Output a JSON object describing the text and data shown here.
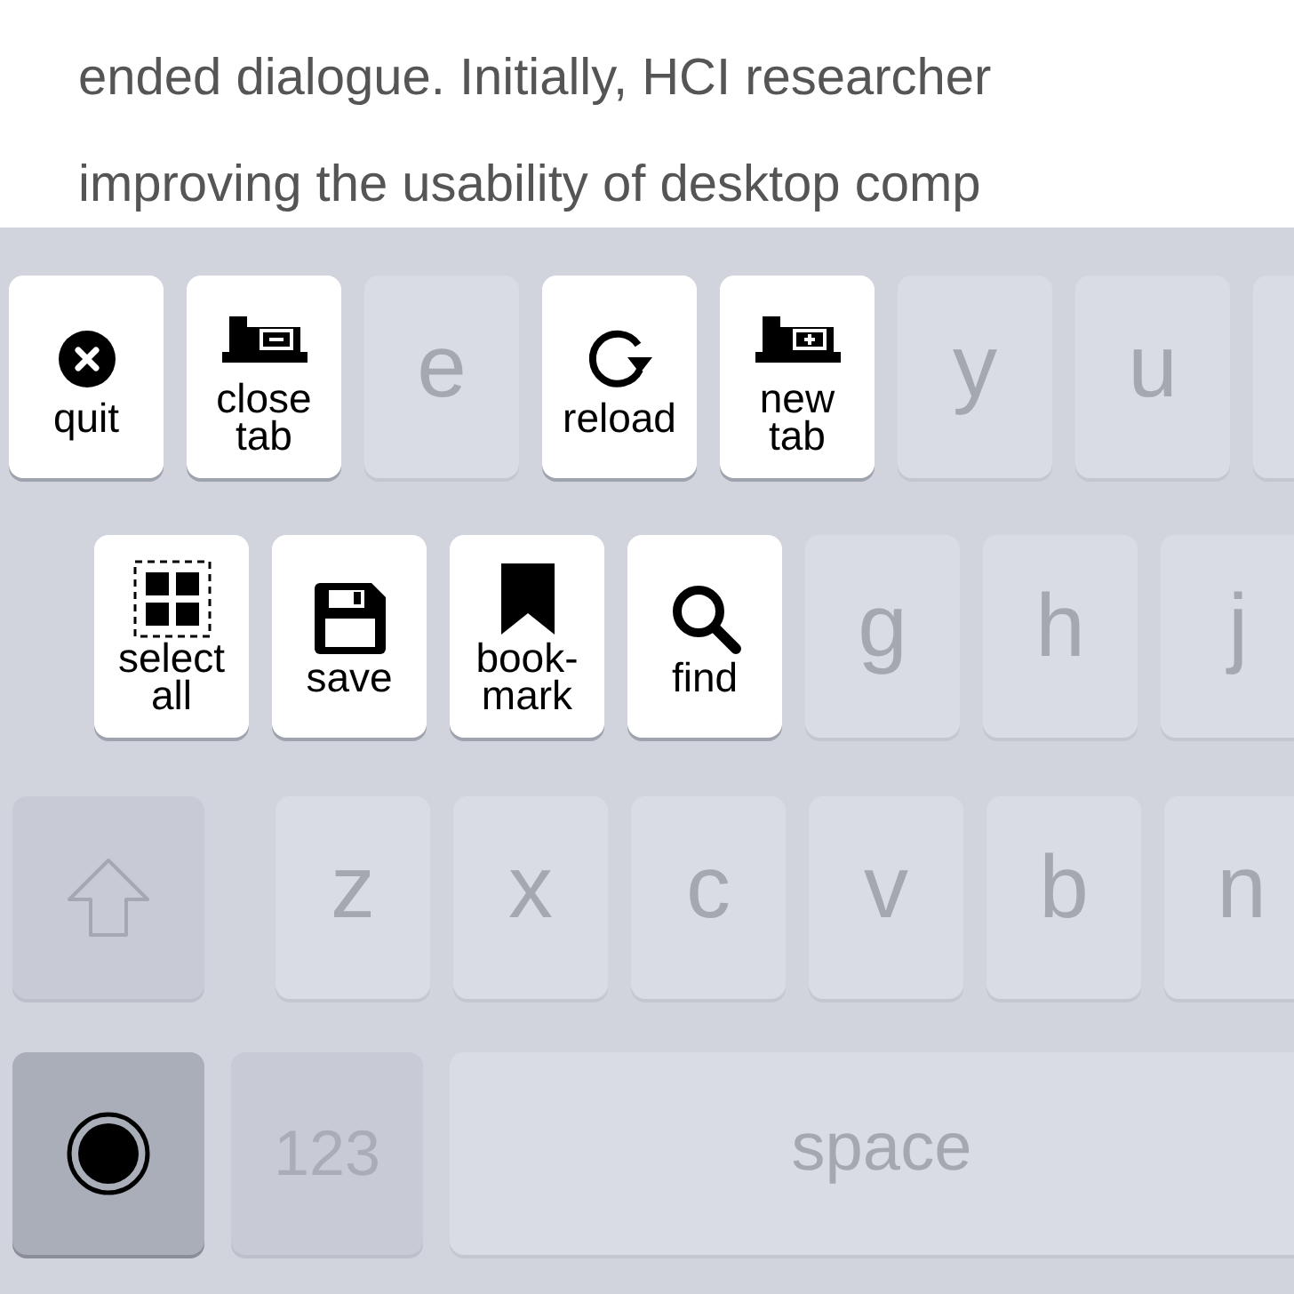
{
  "document": {
    "lines": [
      "ended dialogue. Initially, HCI researcher",
      "improving the usability of desktop comp"
    ]
  },
  "keyboard": {
    "rows": [
      {
        "keys": [
          {
            "kind": "command",
            "label": "quit"
          },
          {
            "kind": "command",
            "label": "close tab"
          },
          {
            "kind": "letter",
            "label": "e"
          },
          {
            "kind": "command",
            "label": "reload"
          },
          {
            "kind": "command",
            "label": "new tab"
          },
          {
            "kind": "letter",
            "label": "y"
          },
          {
            "kind": "letter",
            "label": "u"
          },
          {
            "kind": "blank"
          }
        ]
      },
      {
        "keys": [
          {
            "kind": "command",
            "label": "select all"
          },
          {
            "kind": "command",
            "label": "save"
          },
          {
            "kind": "command",
            "label": "book-mark"
          },
          {
            "kind": "command",
            "label": "find"
          },
          {
            "kind": "letter",
            "label": "g"
          },
          {
            "kind": "letter",
            "label": "h"
          },
          {
            "kind": "letter",
            "label": "j"
          }
        ]
      },
      {
        "keys": [
          {
            "kind": "shift"
          },
          {
            "kind": "letter",
            "label": "z"
          },
          {
            "kind": "letter",
            "label": "x"
          },
          {
            "kind": "letter",
            "label": "c"
          },
          {
            "kind": "letter",
            "label": "v"
          },
          {
            "kind": "letter",
            "label": "b"
          },
          {
            "kind": "letter",
            "label": "n"
          }
        ]
      },
      {
        "keys": [
          {
            "kind": "record",
            "active": true
          },
          {
            "kind": "numbers",
            "label": "123"
          },
          {
            "kind": "space",
            "label": "space"
          }
        ]
      }
    ]
  }
}
